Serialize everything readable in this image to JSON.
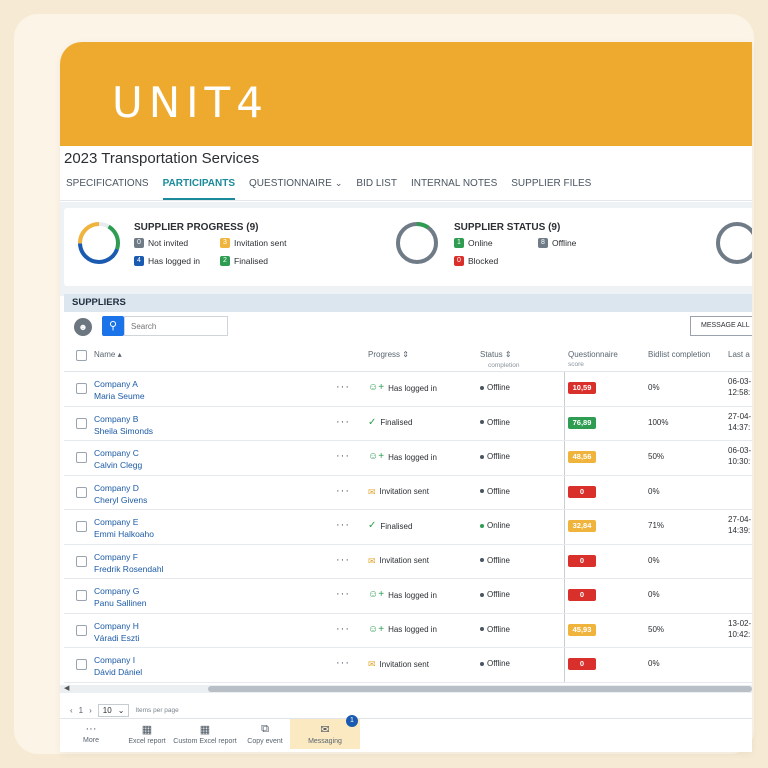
{
  "brand": {
    "logo_text": "UNIT4",
    "color": "#eeaa2f"
  },
  "page": {
    "title": "2023 Transportation Services"
  },
  "tabs": [
    {
      "label": "SPECIFICATIONS",
      "active": false
    },
    {
      "label": "PARTICIPANTS",
      "active": true
    },
    {
      "label": "QUESTIONNAIRE",
      "active": false,
      "has_dropdown": true
    },
    {
      "label": "BID LIST",
      "active": false
    },
    {
      "label": "INTERNAL NOTES",
      "active": false
    },
    {
      "label": "SUPPLIER FILES",
      "active": false
    }
  ],
  "supplier_progress": {
    "title": "SUPPLIER PROGRESS (9)",
    "items": [
      {
        "count": "0",
        "label": "Not invited",
        "color": "#6f7b86"
      },
      {
        "count": "3",
        "label": "Invitation sent",
        "color": "#f0b43c"
      },
      {
        "count": "4",
        "label": "Has logged in",
        "color": "#1a5ab0"
      },
      {
        "count": "2",
        "label": "Finalised",
        "color": "#2e9d52"
      }
    ]
  },
  "supplier_status": {
    "title": "SUPPLIER STATUS (9)",
    "items": [
      {
        "count": "1",
        "label": "Online",
        "color": "#2e9d52"
      },
      {
        "count": "8",
        "label": "Offline",
        "color": "#6f7b86"
      },
      {
        "count": "0",
        "label": "Blocked",
        "color": "#d9302c"
      }
    ]
  },
  "suppliers": {
    "section_title": "SUPPLIERS",
    "search_placeholder": "Search",
    "message_all_label": "MESSAGE ALL",
    "columns": {
      "name": "Name",
      "progress": "Progress",
      "status": "Status",
      "status_sub": "completion",
      "questionnaire": "Questionnaire",
      "questionnaire_sub": "score",
      "bidlist": "Bidlist completion",
      "last": "Last a"
    },
    "rows": [
      {
        "company": "Company A",
        "person": "Maria Seume",
        "progress": "Has logged in",
        "progress_icon": "user-plus-icon",
        "status": "Offline",
        "score": "10,59",
        "score_color": "#d9302c",
        "bid": "0%",
        "last1": "06-03-",
        "last2": "12:58:"
      },
      {
        "company": "Company B",
        "person": "Sheila Simonds",
        "progress": "Finalised",
        "progress_icon": "check-circle-icon",
        "status": "Offline",
        "score": "76,89",
        "score_color": "#2e9d52",
        "bid": "100%",
        "last1": "27-04-",
        "last2": "14:37:"
      },
      {
        "company": "Company C",
        "person": "Calvin Clegg",
        "progress": "Has logged in",
        "progress_icon": "user-plus-icon",
        "status": "Offline",
        "score": "48,56",
        "score_color": "#f0b43c",
        "bid": "50%",
        "last1": "06-03-",
        "last2": "10:30:"
      },
      {
        "company": "Company D",
        "person": "Cheryl Givens",
        "progress": "Invitation sent",
        "progress_icon": "envelope-icon",
        "status": "Offline",
        "score": "0",
        "score_color": "#d9302c",
        "bid": "0%",
        "last1": "",
        "last2": ""
      },
      {
        "company": "Company E",
        "person": "Emmi Halkoaho",
        "progress": "Finalised",
        "progress_icon": "check-circle-icon",
        "status": "Online",
        "score": "32,84",
        "score_color": "#f0b43c",
        "bid": "71%",
        "last1": "27-04-",
        "last2": "14:39:"
      },
      {
        "company": "Company F",
        "person": "Fredrik Rosendahl",
        "progress": "Invitation sent",
        "progress_icon": "envelope-icon",
        "status": "Offline",
        "score": "0",
        "score_color": "#d9302c",
        "bid": "0%",
        "last1": "",
        "last2": ""
      },
      {
        "company": "Company G",
        "person": "Panu Sallinen",
        "progress": "Has logged in",
        "progress_icon": "user-plus-icon",
        "status": "Offline",
        "score": "0",
        "score_color": "#d9302c",
        "bid": "0%",
        "last1": "",
        "last2": ""
      },
      {
        "company": "Company H",
        "person": "Váradi Eszti",
        "progress": "Has logged in",
        "progress_icon": "user-plus-icon",
        "status": "Offline",
        "score": "45,93",
        "score_color": "#f0b43c",
        "bid": "50%",
        "last1": "13-02-",
        "last2": "10:42:"
      },
      {
        "company": "Company I",
        "person": "Dávid Dániel",
        "progress": "Invitation sent",
        "progress_icon": "envelope-icon",
        "status": "Offline",
        "score": "0",
        "score_color": "#d9302c",
        "bid": "0%",
        "last1": "",
        "last2": ""
      }
    ]
  },
  "pager": {
    "page": "1",
    "page_size": "10",
    "page_size_label": "Items per page"
  },
  "footer": [
    {
      "label": "More",
      "icon": "ellipsis-icon"
    },
    {
      "label": "Excel report",
      "icon": "excel-icon"
    },
    {
      "label": "Custom Excel report",
      "icon": "custom-excel-icon"
    },
    {
      "label": "Copy event",
      "icon": "copy-icon"
    },
    {
      "label": "Messaging",
      "icon": "chat-icon",
      "badge": "1"
    }
  ]
}
